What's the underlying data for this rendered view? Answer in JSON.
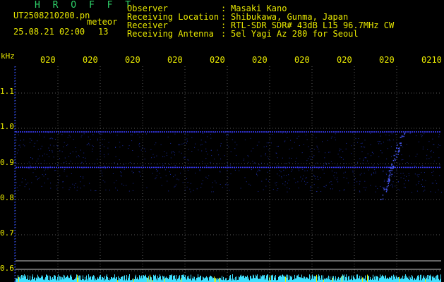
{
  "header": {
    "app_name": "H R O F F T",
    "file_name": "UT2508210200.pn",
    "mode_label": "meteor",
    "datetime": "25.08.21 02:00",
    "count": "13"
  },
  "info": [
    {
      "key": "Observer",
      "sep": ":",
      "value": "Masaki Kano"
    },
    {
      "key": "Receiving Location",
      "sep": ":",
      "value": "Shibukawa, Gunma, Japan"
    },
    {
      "key": "Receiver",
      "sep": ":",
      "value": "RTL-SDR SDR# 43dB L15 96.7MHz CW"
    },
    {
      "key": "Receiving Antenna",
      "sep": ":",
      "value": "5el Yagi Az 280 for Seoul"
    }
  ],
  "chart_data": {
    "type": "heatmap",
    "ylabel": "kHz",
    "y_ticks": [
      "1.1",
      "1.0",
      "0.9",
      "0.8",
      "0.7",
      "0.6"
    ],
    "x_ticks": [
      "020",
      "020",
      "020",
      "020",
      "020",
      "020",
      "020",
      "020",
      "020",
      "0210"
    ],
    "ylim": [
      0.58,
      1.17
    ],
    "signal_lines_khz": [
      0.99,
      0.89
    ],
    "meteor_echo": {
      "freq_range_khz": [
        0.8,
        0.99
      ],
      "x_fraction": 0.89
    },
    "colors": {
      "background": "#000000",
      "signal": "#3b3bff",
      "bottom_noise": "#3fe0ff",
      "grid": "#c8c8c8",
      "text": "#e8e800"
    }
  }
}
